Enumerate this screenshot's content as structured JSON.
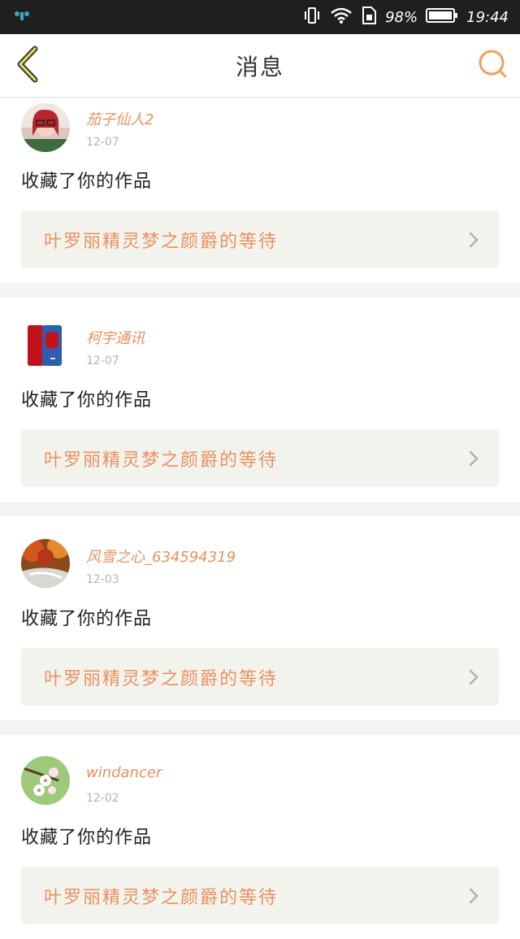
{
  "status_bar": {
    "battery_percent": "98%",
    "time": "19:44",
    "icons": [
      "notification-icon",
      "vibrate-icon",
      "wifi-icon",
      "sim-icon",
      "battery-icon"
    ]
  },
  "header": {
    "title": "消息",
    "back_icon": "chevron-left-icon",
    "search_icon": "search-icon",
    "accent_color": "#f0a05a"
  },
  "feed": [
    {
      "username": "茄子仙人2",
      "date": "12-07",
      "action": "收藏了你的作品",
      "work_title": "叶罗丽精灵梦之颜爵的等待",
      "avatar": "portrait-photo"
    },
    {
      "username": "柯宇通讯",
      "date": "12-07",
      "action": "收藏了你的作品",
      "work_title": "叶罗丽精灵梦之颜爵的等待",
      "avatar": "phone-photo"
    },
    {
      "username": "风雪之心_634594319",
      "date": "12-03",
      "action": "收藏了你的作品",
      "work_title": "叶罗丽精灵梦之颜爵的等待",
      "avatar": "waterfall-photo"
    },
    {
      "username": "windancer",
      "date": "12-02",
      "action": "收藏了你的作品",
      "work_title": "叶罗丽精灵梦之颜爵的等待",
      "avatar": "blossom-photo"
    }
  ]
}
